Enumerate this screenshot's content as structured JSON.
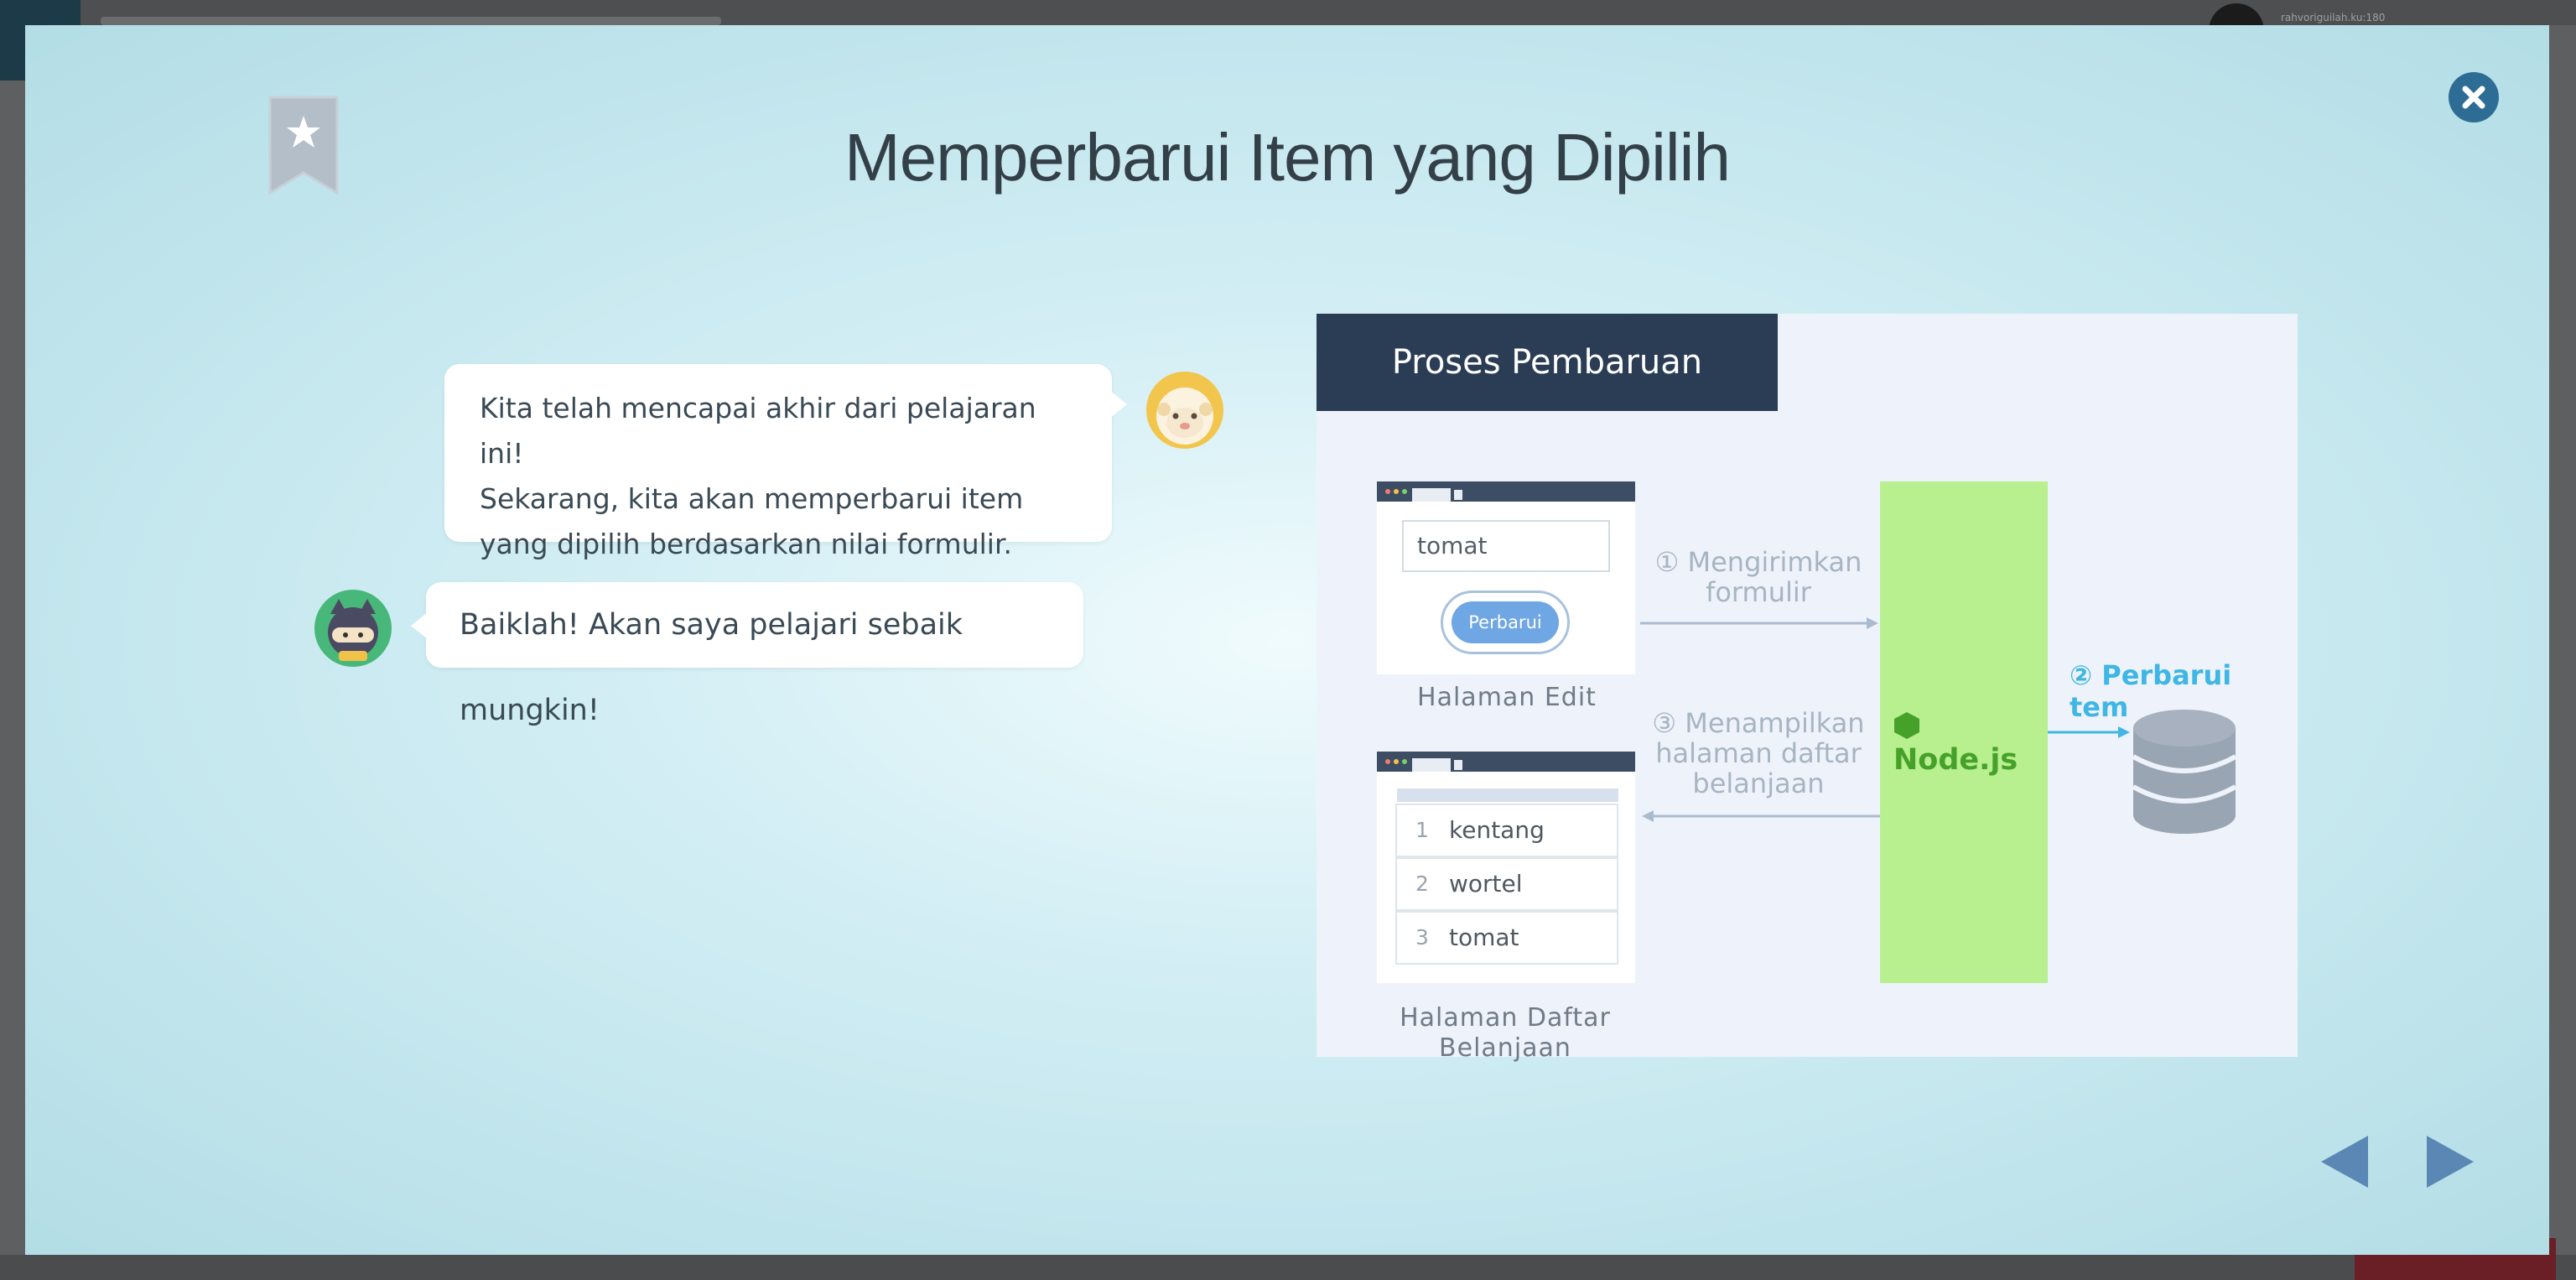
{
  "background": {
    "username": "rahvoriguilah.ku:180"
  },
  "modal": {
    "title": "Memperbarui Item yang Dipilih",
    "bookmark_icon": "bookmark-star-icon",
    "close_icon": "close-icon"
  },
  "dialog": {
    "message1": {
      "lines": [
        "Kita telah mencapai akhir dari pelajaran ini!",
        "Sekarang, kita akan memperbarui item",
        "yang dipilih berdasarkan nilai formulir."
      ],
      "avatar": "sheep-avatar"
    },
    "message2": {
      "text": "Baiklah! Akan saya pelajari sebaik mungkin!",
      "avatar": "ninja-cat-avatar"
    }
  },
  "diagram": {
    "header": "Proses Pembaruan",
    "edit_page": {
      "input_value": "tomat",
      "button_label": "Perbarui",
      "caption": "Halaman Edit"
    },
    "list_page": {
      "items": [
        {
          "num": "1",
          "text": "kentang"
        },
        {
          "num": "2",
          "text": "wortel"
        },
        {
          "num": "3",
          "text": "tomat"
        }
      ],
      "caption_line1": "Halaman Daftar",
      "caption_line2": "Belanjaan"
    },
    "step1": {
      "line1": "① Mengirimkan",
      "line2": "formulir"
    },
    "step3": {
      "line1": "③ Menampilkan",
      "line2": "halaman daftar",
      "line3": "belanjaan"
    },
    "server_label": "Node.js",
    "step2": "② Perbarui tem"
  },
  "navigation": {
    "prev_icon": "arrow-left-icon",
    "next_icon": "arrow-right-icon"
  },
  "colors": {
    "title": "#344048",
    "header": "#2b3d55",
    "node_green": "#b8ef8f",
    "accent_blue": "#3fb6e4",
    "nav_blue": "#5b87b5",
    "close_blue": "#2d6c94"
  }
}
